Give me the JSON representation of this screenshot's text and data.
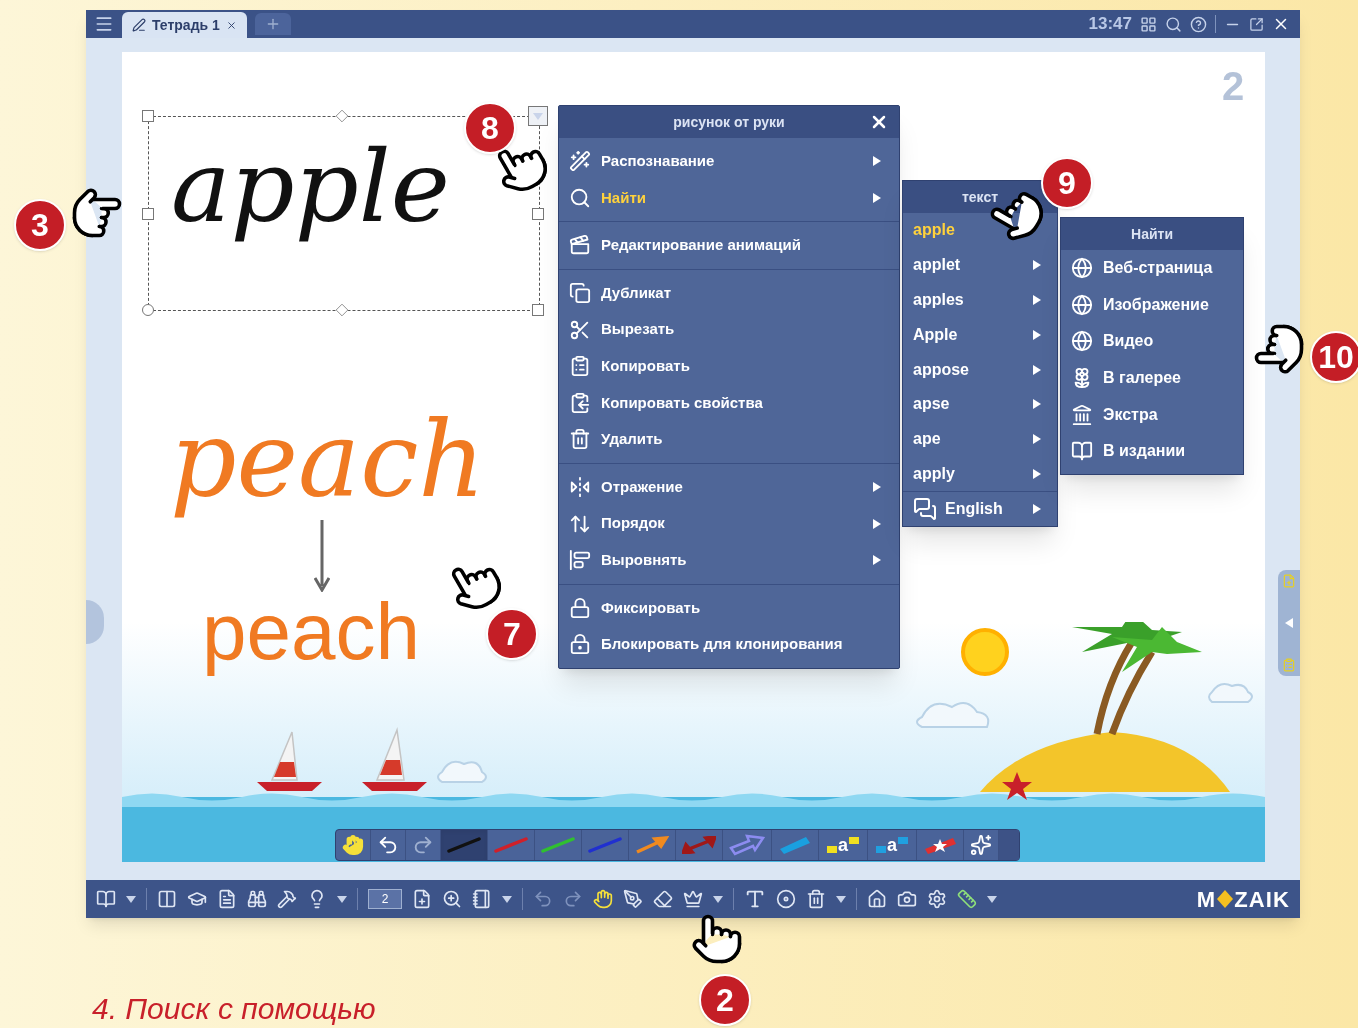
{
  "title_bar": {
    "tab": {
      "label": "Тетрадь 1",
      "selected": true
    },
    "time": "13:47"
  },
  "canvas": {
    "page_number": "2",
    "handwriting": "apple",
    "handwriting_2": "peach",
    "typed_text": "peach"
  },
  "pen_toolbar": [
    {
      "kind": "hand",
      "selected": false
    },
    {
      "kind": "undo",
      "selected": false
    },
    {
      "kind": "redo",
      "selected": false
    },
    {
      "kind": "pen",
      "color": "#111111",
      "selected": true
    },
    {
      "kind": "pen",
      "color": "#d0202a",
      "selected": false
    },
    {
      "kind": "pen",
      "color": "#30c030",
      "selected": false
    },
    {
      "kind": "pen",
      "color": "#2030d0",
      "selected": false
    },
    {
      "kind": "arrow",
      "color": "#f08a20",
      "selected": false
    },
    {
      "kind": "double-arrow",
      "color": "#a01818",
      "selected": false
    },
    {
      "kind": "block-arrow",
      "color": "#8c8cf0",
      "selected": false
    },
    {
      "kind": "highlighter",
      "color": "#1aa0e0",
      "selected": false
    },
    {
      "kind": "letter-marker",
      "color": "#f0e020",
      "label": "a",
      "selected": false
    },
    {
      "kind": "letter-marker",
      "color": "#20a0e0",
      "label": "a",
      "selected": false
    },
    {
      "kind": "star-marker",
      "color": "#e03030",
      "selected": false
    },
    {
      "kind": "wand",
      "selected": false
    }
  ],
  "context_menu": {
    "title": "рисунок от руки",
    "groups": [
      [
        {
          "label": "Распознавание",
          "has_submenu": true,
          "selected": false
        },
        {
          "label": "Найти",
          "has_submenu": true,
          "selected": true
        }
      ],
      [
        {
          "label": "Редактирование анимаций",
          "has_submenu": false,
          "selected": false
        }
      ],
      [
        {
          "label": "Дубликат",
          "has_submenu": false,
          "selected": false
        },
        {
          "label": "Вырезать",
          "has_submenu": false,
          "selected": false
        },
        {
          "label": "Копировать",
          "has_submenu": false,
          "selected": false
        },
        {
          "label": "Копировать свойства",
          "has_submenu": false,
          "selected": false
        },
        {
          "label": "Удалить",
          "has_submenu": false,
          "selected": false
        }
      ],
      [
        {
          "label": "Отражение",
          "has_submenu": true,
          "selected": false
        },
        {
          "label": "Порядок",
          "has_submenu": true,
          "selected": false
        },
        {
          "label": "Выровнять",
          "has_submenu": true,
          "selected": false
        }
      ],
      [
        {
          "label": "Фиксировать",
          "has_submenu": false,
          "selected": false
        },
        {
          "label": "Блокировать для клонирования",
          "has_submenu": false,
          "selected": false
        }
      ]
    ]
  },
  "text_menu": {
    "title": "текст",
    "items": [
      {
        "kind": "word",
        "label": "apple",
        "has_submenu": false,
        "selected": true
      },
      {
        "kind": "word",
        "label": "applet",
        "has_submenu": true,
        "selected": false
      },
      {
        "kind": "word",
        "label": "apples",
        "has_submenu": true,
        "selected": false
      },
      {
        "kind": "word",
        "label": "Apple",
        "has_submenu": true,
        "selected": false
      },
      {
        "kind": "word",
        "label": "appose",
        "has_submenu": true,
        "selected": false
      },
      {
        "kind": "word",
        "label": "apse",
        "has_submenu": true,
        "selected": false
      },
      {
        "kind": "word",
        "label": "ape",
        "has_submenu": true,
        "selected": false
      },
      {
        "kind": "word",
        "label": "apply",
        "has_submenu": true,
        "selected": false
      },
      {
        "kind": "language",
        "label": "English",
        "has_submenu": true,
        "selected": false
      }
    ]
  },
  "find_menu": {
    "title": "Найти",
    "items": [
      {
        "label": "Веб-страница"
      },
      {
        "label": "Изображение"
      },
      {
        "label": "Видео"
      },
      {
        "label": "В галерее"
      },
      {
        "label": "Экстра"
      },
      {
        "label": "В издании"
      }
    ]
  },
  "bottom_toolbar": {
    "page_field": "2",
    "logo_left": "M",
    "logo_right": "ZAIK"
  },
  "callouts": [
    "3",
    "8",
    "9",
    "10",
    "7",
    "2"
  ],
  "caption": "4. Поиск с помощью"
}
